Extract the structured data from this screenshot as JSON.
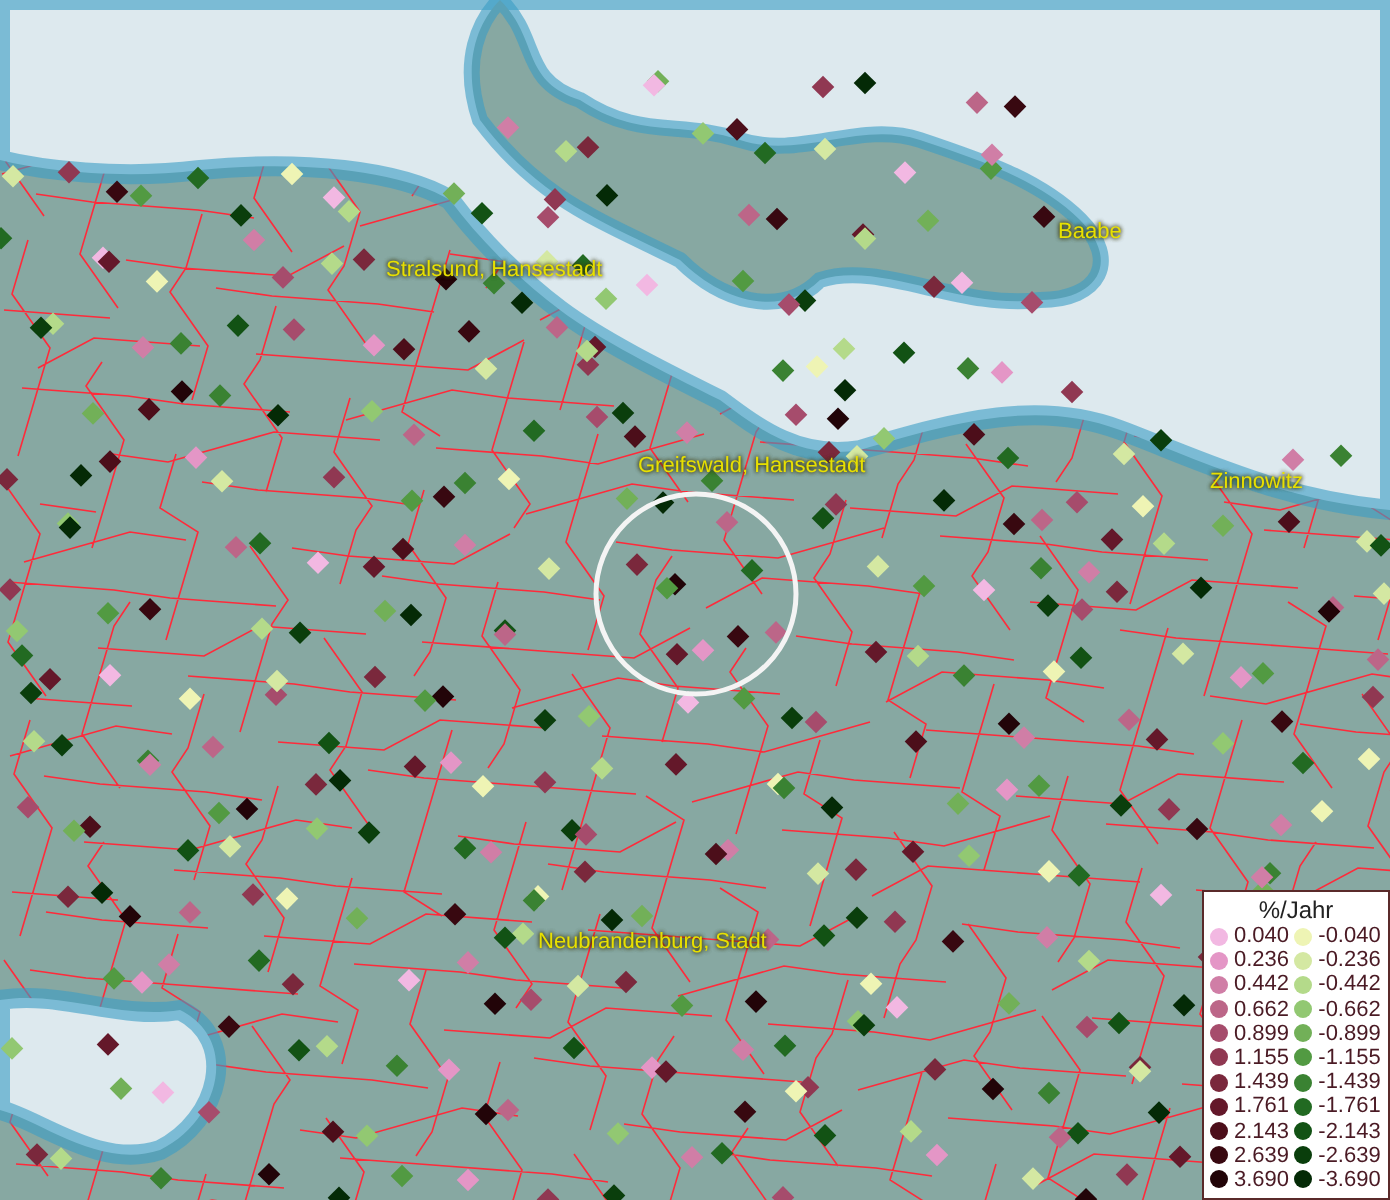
{
  "map": {
    "places": [
      {
        "name": "Stralsund, Hansestadt"
      },
      {
        "name": "Baabe"
      },
      {
        "name": "Greifswald, Hansestadt"
      },
      {
        "name": "Zinnowitz"
      },
      {
        "name": "Neubrandenburg, Stadt"
      }
    ]
  },
  "legend": {
    "title": "%/Jahr",
    "columns": [
      [
        {
          "value": "0.040",
          "color": "#f2b8e2"
        },
        {
          "value": "0.236",
          "color": "#e496c6"
        },
        {
          "value": "0.442",
          "color": "#d07ea6"
        },
        {
          "value": "0.662",
          "color": "#bc6688"
        },
        {
          "value": "0.899",
          "color": "#a64c6c"
        },
        {
          "value": "1.155",
          "color": "#903852"
        },
        {
          "value": "1.439",
          "color": "#7a283c"
        },
        {
          "value": "1.761",
          "color": "#64182a"
        },
        {
          "value": "2.143",
          "color": "#4c0e1a"
        },
        {
          "value": "2.639",
          "color": "#380810"
        },
        {
          "value": "3.690",
          "color": "#220408"
        }
      ],
      [
        {
          "value": "-0.040",
          "color": "#eef4b4"
        },
        {
          "value": "-0.236",
          "color": "#d4e8a2"
        },
        {
          "value": "-0.442",
          "color": "#b4da8a"
        },
        {
          "value": "-0.662",
          "color": "#92c872"
        },
        {
          "value": "-0.899",
          "color": "#72b058"
        },
        {
          "value": "-1.155",
          "color": "#529a42"
        },
        {
          "value": "-1.439",
          "color": "#3a8232"
        },
        {
          "value": "-1.761",
          "color": "#226a22"
        },
        {
          "value": "-2.143",
          "color": "#125214"
        },
        {
          "value": "-2.639",
          "color": "#0a3e0c"
        },
        {
          "value": "-3.690",
          "color": "#042a06"
        }
      ]
    ]
  }
}
